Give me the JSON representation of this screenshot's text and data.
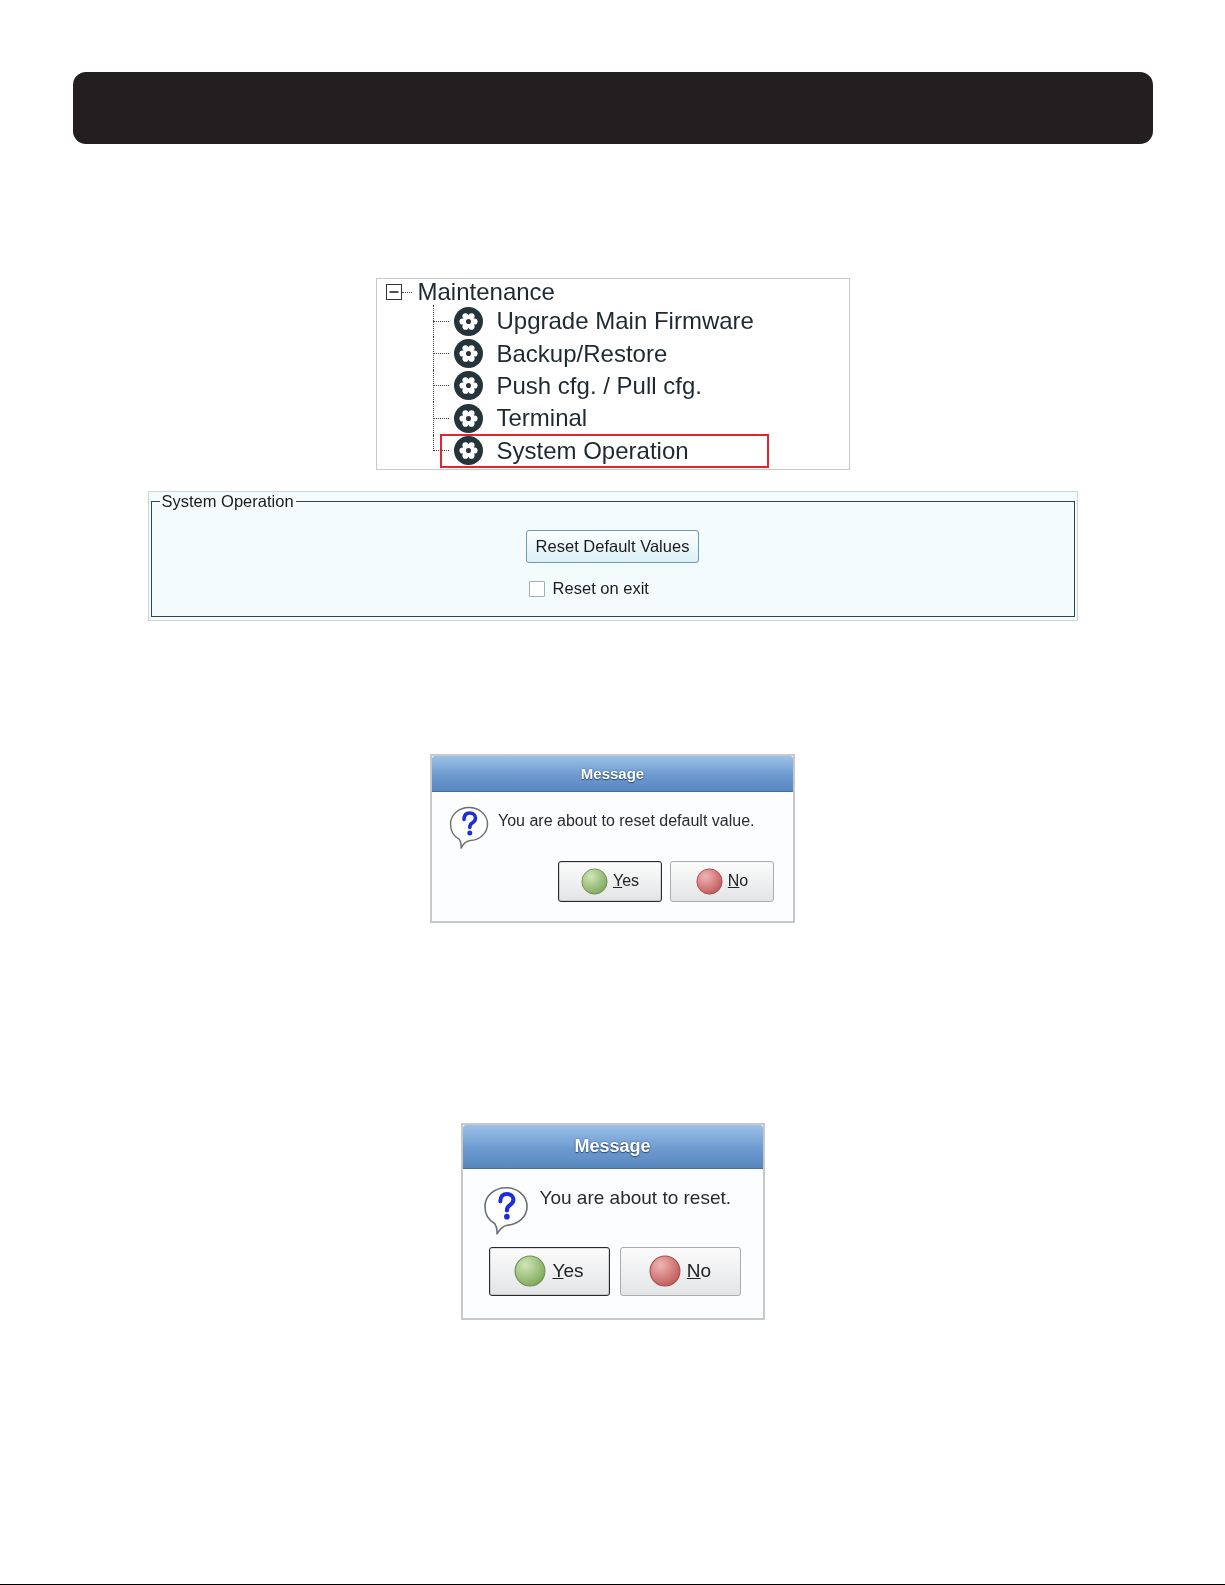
{
  "tree": {
    "label": "Maintenance",
    "expanded": true,
    "children": [
      {
        "label": "Upgrade Main Firmware",
        "highlighted": false
      },
      {
        "label": "Backup/Restore",
        "highlighted": false
      },
      {
        "label": "Push cfg. / Pull cfg.",
        "highlighted": false
      },
      {
        "label": "Terminal",
        "highlighted": false
      },
      {
        "label": "System Operation",
        "highlighted": true
      }
    ]
  },
  "group": {
    "title": "System Operation",
    "button": "Reset Default Values",
    "checkbox": {
      "label": "Reset on exit",
      "checked": false
    }
  },
  "dialogs": [
    {
      "title": "Message",
      "message": "You are about to reset default value.",
      "buttons": [
        {
          "kind": "yes",
          "label": "Yes",
          "focused": true
        },
        {
          "kind": "no",
          "label": "No",
          "focused": false
        }
      ]
    },
    {
      "title": "Message",
      "message": "You are about to reset.",
      "buttons": [
        {
          "kind": "yes",
          "label": "Yes",
          "focused": true
        },
        {
          "kind": "no",
          "label": "No",
          "focused": false
        }
      ]
    }
  ]
}
